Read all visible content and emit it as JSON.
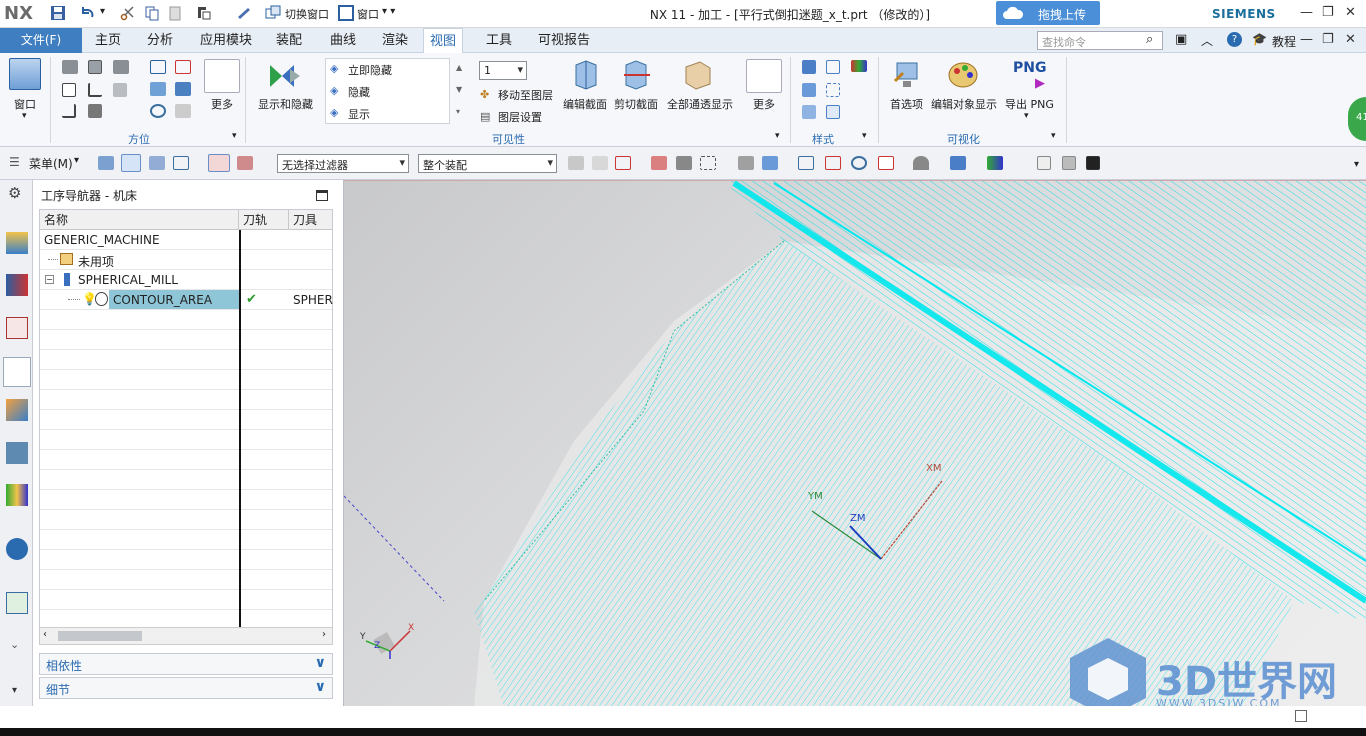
{
  "app": {
    "logo": "NX",
    "window_title": "NX 11 - 加工 - [平行式倒扣迷题_x_t.prt （修改的）]",
    "upload_label": "拖拽上传",
    "brand": "SIEMENS",
    "quick_access": {
      "switch_window": "切换窗口",
      "window": "窗口"
    }
  },
  "menu": {
    "file": "文件(F)",
    "tabs": [
      "主页",
      "分析",
      "应用模块",
      "装配",
      "曲线",
      "渲染",
      "视图",
      "工具",
      "可视报告"
    ],
    "active_tab": "视图",
    "search_placeholder": "查找命令",
    "tutorial": "教程"
  },
  "ribbon": {
    "window_label": "窗口",
    "orient_group": "方位",
    "more1": "更多",
    "show_hide": "显示和隐藏",
    "immediate_hide": "立即隐藏",
    "hide": "隐藏",
    "show": "显示",
    "layer_value": "1",
    "move_to_layer": "移动至图层",
    "layer_settings": "图层设置",
    "edit_section": "编辑截面",
    "clip_section": "剪切截面",
    "all_through": "全部通透显示",
    "more2": "更多",
    "visibility_group": "可见性",
    "style_group": "样式",
    "preferences": "首选项",
    "edit_display": "编辑对象显示",
    "export_png": "导出 PNG",
    "png_text": "PNG",
    "visualize_group": "可视化",
    "badge": "41"
  },
  "toolbar": {
    "menu_label": "菜单(M)",
    "filter": "无选择过滤器",
    "scope": "整个装配"
  },
  "navigator": {
    "title": "工序导航器 - 机床",
    "columns": [
      "名称",
      "刀轨",
      "刀具"
    ],
    "rows": [
      {
        "name": "GENERIC_MACHINE",
        "path": "",
        "tool": ""
      },
      {
        "name": "未用项",
        "path": "",
        "tool": ""
      },
      {
        "name": "SPHERICAL_MILL",
        "path": "",
        "tool": ""
      },
      {
        "name": "CONTOUR_AREA",
        "path": "✔",
        "tool": "SPHER"
      }
    ],
    "dependencies": "相依性",
    "details": "细节"
  },
  "viewport": {
    "axes": {
      "x": "XM",
      "y": "YM",
      "z": "ZM"
    },
    "triad": {
      "x": "X",
      "y": "Y",
      "z": "Z"
    },
    "watermark": "3D世界网",
    "watermark_url": "WWW.3DSJW.COM"
  },
  "colors": {
    "accent": "#3f7fc1",
    "toolpath": "#00e0e8",
    "selection": "#8ec6d8"
  }
}
